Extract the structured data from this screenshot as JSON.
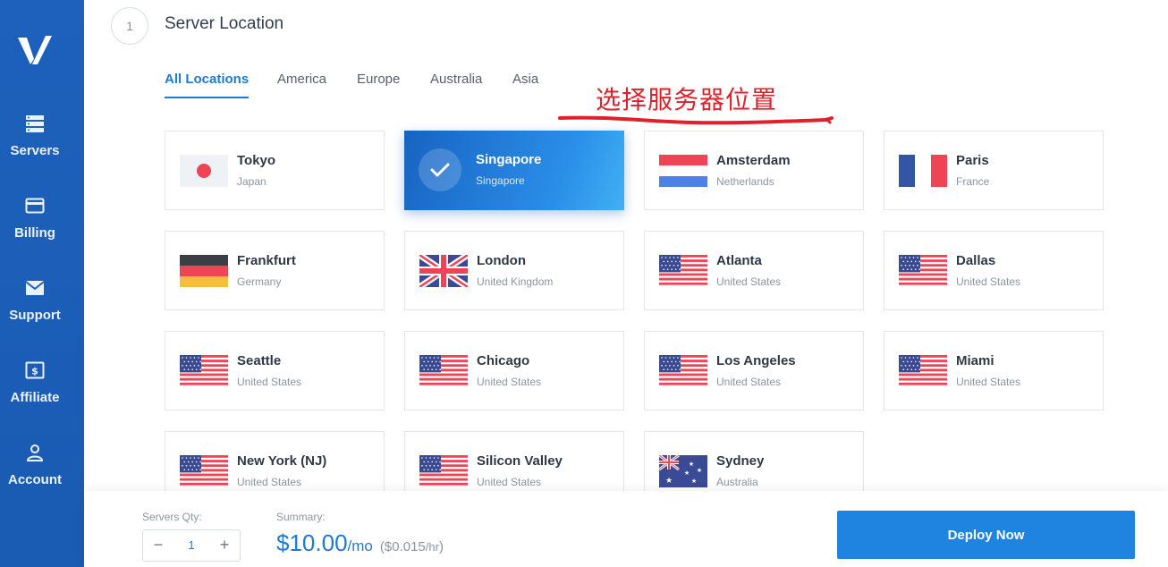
{
  "nav": {
    "items": [
      {
        "label": "Servers",
        "icon": "servers-icon"
      },
      {
        "label": "Billing",
        "icon": "billing-icon"
      },
      {
        "label": "Support",
        "icon": "support-icon"
      },
      {
        "label": "Affiliate",
        "icon": "affiliate-icon"
      },
      {
        "label": "Account",
        "icon": "account-icon"
      }
    ]
  },
  "step": {
    "number": "1",
    "title": "Server Location"
  },
  "tabs": [
    "All Locations",
    "America",
    "Europe",
    "Australia",
    "Asia"
  ],
  "active_tab": "All Locations",
  "annotation": "选择服务器位置",
  "locations": [
    {
      "city": "Tokyo",
      "country": "Japan",
      "flag": "japan-flag"
    },
    {
      "city": "Singapore",
      "country": "Singapore",
      "flag": "check-icon",
      "selected": true
    },
    {
      "city": "Amsterdam",
      "country": "Netherlands",
      "flag": "netherlands-flag"
    },
    {
      "city": "Paris",
      "country": "France",
      "flag": "france-flag"
    },
    {
      "city": "Frankfurt",
      "country": "Germany",
      "flag": "germany-flag"
    },
    {
      "city": "London",
      "country": "United Kingdom",
      "flag": "uk-flag"
    },
    {
      "city": "Atlanta",
      "country": "United States",
      "flag": "us-flag"
    },
    {
      "city": "Dallas",
      "country": "United States",
      "flag": "us-flag"
    },
    {
      "city": "Seattle",
      "country": "United States",
      "flag": "us-flag"
    },
    {
      "city": "Chicago",
      "country": "United States",
      "flag": "us-flag"
    },
    {
      "city": "Los Angeles",
      "country": "United States",
      "flag": "us-flag"
    },
    {
      "city": "Miami",
      "country": "United States",
      "flag": "us-flag"
    },
    {
      "city": "New York (NJ)",
      "country": "United States",
      "flag": "us-flag"
    },
    {
      "city": "Silicon Valley",
      "country": "United States",
      "flag": "us-flag"
    },
    {
      "city": "Sydney",
      "country": "Australia",
      "flag": "australia-flag"
    }
  ],
  "footer": {
    "qty_label": "Servers Qty:",
    "qty_minus": "−",
    "qty_value": "1",
    "qty_plus": "+",
    "summary_label": "Summary:",
    "price": "$10.00",
    "price_unit": "/mo",
    "price_hourly_open": "(",
    "price_hourly": "$0.015",
    "price_hourly_unit": "/hr",
    "price_hourly_close": ")",
    "deploy_label": "Deploy Now"
  },
  "colors": {
    "sidebar": "#1d61bc",
    "accent": "#1e7ad8",
    "annotation": "#e0212b",
    "deploy_button": "#1e84e0"
  }
}
